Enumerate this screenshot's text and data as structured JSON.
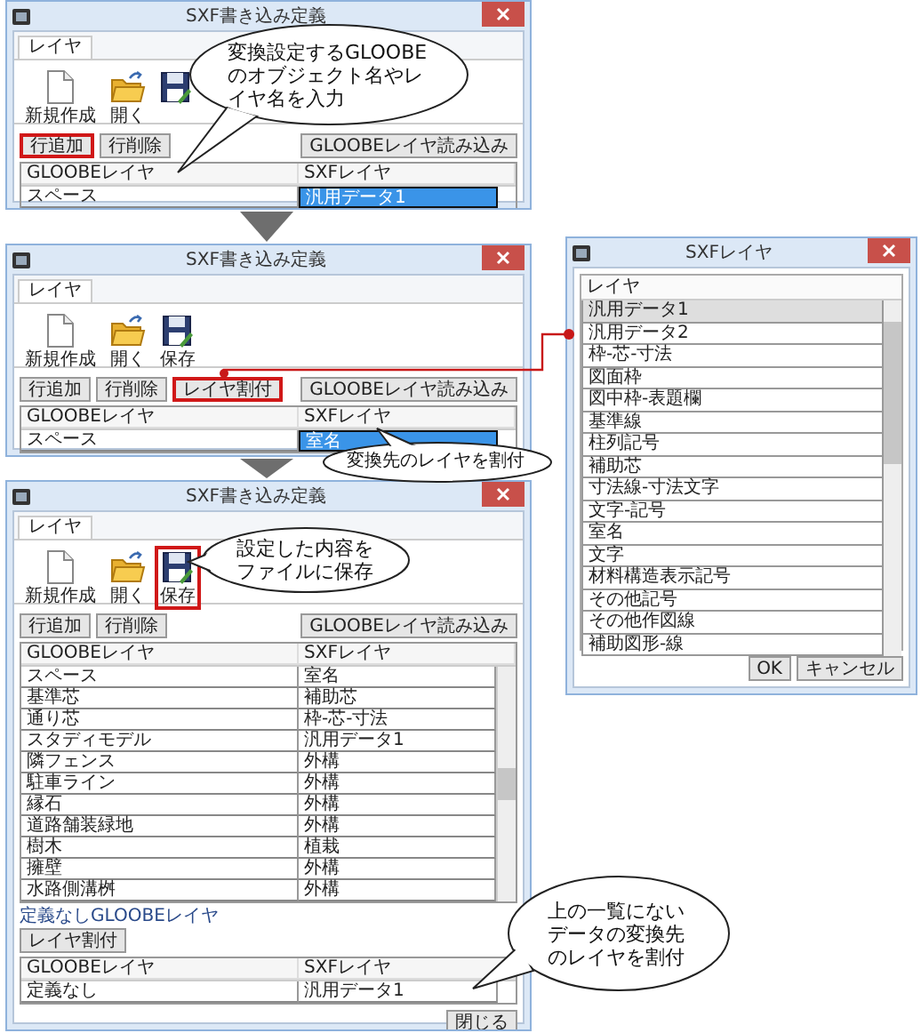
{
  "windows": [
    {
      "title": "SXF書き込み定義",
      "tabs": [
        {
          "label": "レイヤ",
          "selected": true
        }
      ],
      "toolbar": [
        {
          "kind": "new",
          "label": "新規作成",
          "highlighted": false
        },
        {
          "kind": "open",
          "label": "開く",
          "highlighted": false
        },
        {
          "kind": "save",
          "highlighted": false
        }
      ],
      "buttons": [
        {
          "label": "行追加",
          "highlighted": true
        },
        {
          "label": "行削除",
          "highlighted": false
        }
      ],
      "load_button": "GLOOBEレイヤ読み込み",
      "columns": [
        "GLOOBEレイヤ",
        "SXFレイヤ"
      ],
      "rows": [
        {
          "gloobe": "スペース",
          "sxf": "汎用データ1",
          "selected": true
        }
      ]
    },
    {
      "title": "SXF書き込み定義",
      "tabs": [
        {
          "label": "レイヤ",
          "selected": true
        }
      ],
      "toolbar": [
        {
          "kind": "new",
          "label": "新規作成",
          "highlighted": false
        },
        {
          "kind": "open",
          "label": "開く",
          "highlighted": false
        },
        {
          "kind": "save",
          "label": "保存",
          "highlighted": false
        }
      ],
      "buttons": [
        {
          "label": "行追加",
          "highlighted": false
        },
        {
          "label": "行削除",
          "highlighted": false
        },
        {
          "label": "レイヤ割付",
          "highlighted": true
        }
      ],
      "load_button": "GLOOBEレイヤ読み込み",
      "columns": [
        "GLOOBEレイヤ",
        "SXFレイヤ"
      ],
      "rows": [
        {
          "gloobe": "スペース",
          "sxf": "室名",
          "selected": true
        }
      ]
    },
    {
      "title": "SXF書き込み定義",
      "tabs": [
        {
          "label": "レイヤ",
          "selected": true
        }
      ],
      "toolbar": [
        {
          "kind": "new",
          "label": "新規作成",
          "highlighted": false
        },
        {
          "kind": "open",
          "label": "開く",
          "highlighted": false
        },
        {
          "kind": "save",
          "label": "保存",
          "highlighted": true
        }
      ],
      "buttons": [
        {
          "label": "行追加",
          "highlighted": false
        },
        {
          "label": "行削除",
          "highlighted": false
        }
      ],
      "load_button": "GLOOBEレイヤ読み込み",
      "columns": [
        "GLOOBEレイヤ",
        "SXFレイヤ"
      ],
      "rows": [
        {
          "gloobe": "スペース",
          "sxf": "室名",
          "selected": false
        },
        {
          "gloobe": "基準芯",
          "sxf": "補助芯",
          "selected": false
        },
        {
          "gloobe": "通り芯",
          "sxf": "枠-芯-寸法",
          "selected": false
        },
        {
          "gloobe": "スタディモデル",
          "sxf": "汎用データ1",
          "selected": false
        },
        {
          "gloobe": "隣フェンス",
          "sxf": "外構",
          "selected": false
        },
        {
          "gloobe": "駐車ライン",
          "sxf": "外構",
          "selected": false
        },
        {
          "gloobe": "縁石",
          "sxf": "外構",
          "selected": false
        },
        {
          "gloobe": "道路舗装緑地",
          "sxf": "外構",
          "selected": false
        },
        {
          "gloobe": "樹木",
          "sxf": "植栽",
          "selected": false
        },
        {
          "gloobe": "擁壁",
          "sxf": "外構",
          "selected": false
        },
        {
          "gloobe": "水路側溝桝",
          "sxf": "外構",
          "selected": false
        }
      ],
      "undefined_section": {
        "label": "定義なしGLOOBEレイヤ",
        "button": "レイヤ割付",
        "columns": [
          "GLOOBEレイヤ",
          "SXFレイヤ"
        ],
        "rows": [
          {
            "gloobe": "定義なし",
            "sxf": "汎用データ1",
            "selected": false
          }
        ]
      },
      "close_button": "閉じる"
    }
  ],
  "layer_dialog": {
    "title": "SXFレイヤ",
    "column": "レイヤ",
    "items": [
      {
        "label": "汎用データ1",
        "selected": true
      },
      {
        "label": "汎用データ2",
        "selected": false
      },
      {
        "label": "枠-芯-寸法",
        "selected": false
      },
      {
        "label": "図面枠",
        "selected": false
      },
      {
        "label": "図中枠-表題欄",
        "selected": false
      },
      {
        "label": "基準線",
        "selected": false
      },
      {
        "label": "柱列記号",
        "selected": false
      },
      {
        "label": "補助芯",
        "selected": false
      },
      {
        "label": "寸法線-寸法文字",
        "selected": false
      },
      {
        "label": "文字-記号",
        "selected": false
      },
      {
        "label": "室名",
        "selected": false
      },
      {
        "label": "文字",
        "selected": false
      },
      {
        "label": "材料構造表示記号",
        "selected": false
      },
      {
        "label": "その他記号",
        "selected": false
      },
      {
        "label": "その他作図線",
        "selected": false
      },
      {
        "label": "補助図形-線",
        "selected": false
      }
    ],
    "buttons": [
      "OK",
      "キャンセル"
    ]
  },
  "callouts": [
    {
      "text": "変換設定するGLOOBEのオブジェクト名やレイヤ名を入力"
    },
    {
      "text": "変換先のレイヤを割付"
    },
    {
      "text": "設定した内容をファイルに保存"
    },
    {
      "text": "上の一覧にないデータの変換先のレイヤを割付"
    }
  ]
}
